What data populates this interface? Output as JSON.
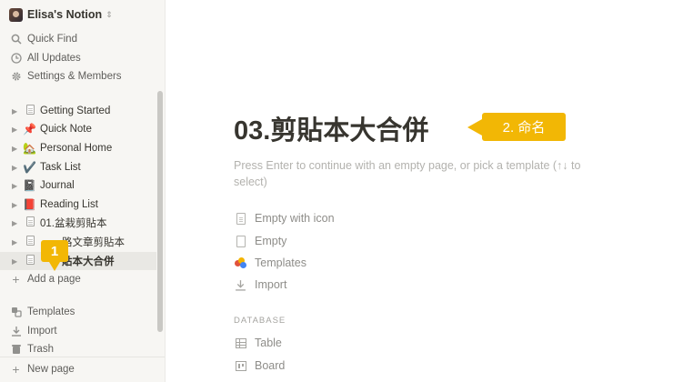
{
  "sidebar": {
    "workspace": {
      "name": "Elisa's Notion",
      "chevron": "⇕"
    },
    "nav": [
      {
        "label": "Quick Find",
        "icon": "search-icon"
      },
      {
        "label": "All Updates",
        "icon": "clock-icon"
      },
      {
        "label": "Settings & Members",
        "icon": "gear-icon"
      }
    ],
    "pages": [
      {
        "label": "Getting Started",
        "emoji": ""
      },
      {
        "label": "Quick Note",
        "emoji": "📌"
      },
      {
        "label": "Personal Home",
        "emoji": "🏡"
      },
      {
        "label": "Task List",
        "emoji": "✔️"
      },
      {
        "label": "Journal",
        "emoji": "📓"
      },
      {
        "label": "Reading List",
        "emoji": "📕"
      },
      {
        "label": "01.盆栽剪貼本",
        "emoji": ""
      },
      {
        "label": "路文章剪貼本",
        "emoji": ""
      },
      {
        "label": "貼本大合併",
        "emoji": ""
      }
    ],
    "add_page": "Add a page",
    "footer": [
      {
        "label": "Templates",
        "icon": "templates-icon"
      },
      {
        "label": "Import",
        "icon": "import-icon"
      },
      {
        "label": "Trash",
        "icon": "trash-icon"
      }
    ],
    "new_page": "New page"
  },
  "callouts": {
    "step1": "1",
    "step2": "2. 命名"
  },
  "main": {
    "title": "03.剪貼本大合併",
    "hint": "Press Enter to continue with an empty page, or pick a template (↑↓ to select)",
    "options": [
      {
        "label": "Empty with icon",
        "icon": "page-with-icon-icon"
      },
      {
        "label": "Empty",
        "icon": "page-icon"
      },
      {
        "label": "Templates",
        "icon": "templates-icon"
      },
      {
        "label": "Import",
        "icon": "import-icon"
      }
    ],
    "database_heading": "DATABASE",
    "database_options": [
      {
        "label": "Table",
        "icon": "table-icon"
      },
      {
        "label": "Board",
        "icon": "board-icon"
      }
    ]
  },
  "colors": {
    "accent_callout": "#f2b705",
    "sidebar_bg": "#f7f6f3"
  }
}
